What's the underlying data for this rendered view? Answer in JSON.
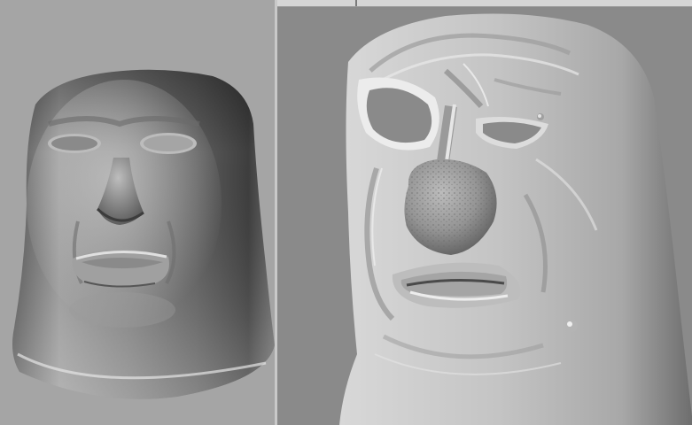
{
  "colors": {
    "left_viewport_bg": "#a5a5a5",
    "right_viewport_bg": "#8a8a8a",
    "divider": "#c9c9c9",
    "model_shade_light": "#dcdcdc",
    "model_shade_dark": "#3a3a3a"
  },
  "viewports": [
    {
      "label": "",
      "model": "low-detail-face-mesh"
    },
    {
      "label": "",
      "model": "sculpted-face-mesh"
    }
  ]
}
